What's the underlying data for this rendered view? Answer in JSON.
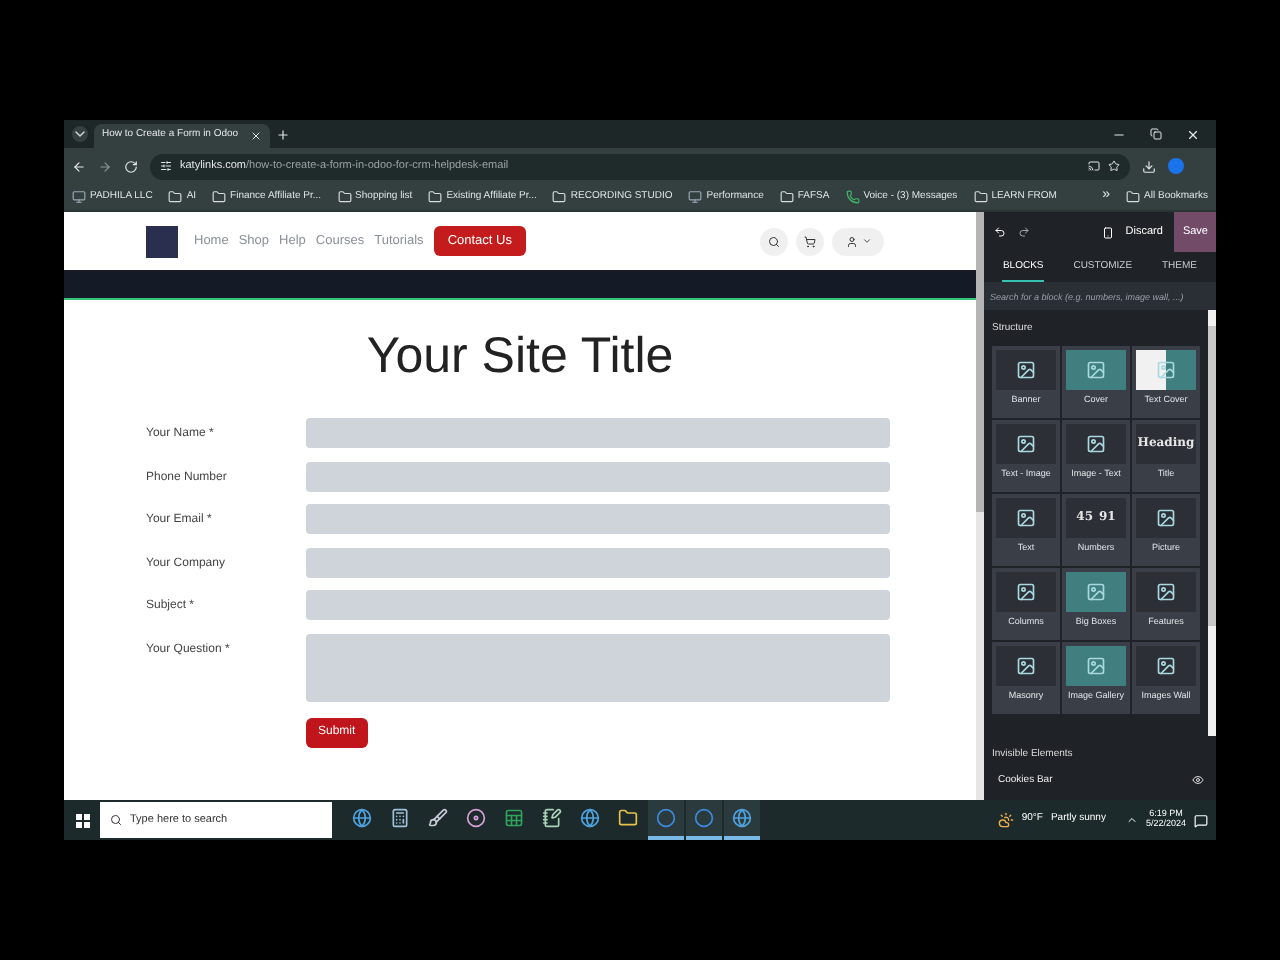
{
  "browser": {
    "tab_title": "How to Create a Form in Odoo",
    "url_host": "katylinks.com",
    "url_path": "/how-to-create-a-form-in-odoo-for-crm-helpdesk-email",
    "bookmarks": [
      {
        "label": "PADHILA LLC",
        "kind": "site"
      },
      {
        "label": "AI",
        "kind": "folder"
      },
      {
        "label": "Finance Affiliate Pr...",
        "kind": "folder"
      },
      {
        "label": "Shopping list",
        "kind": "folder"
      },
      {
        "label": "Existing Affiliate Pr...",
        "kind": "folder"
      },
      {
        "label": "RECORDING STUDIO",
        "kind": "folder"
      },
      {
        "label": "Performance",
        "kind": "site"
      },
      {
        "label": "FAFSA",
        "kind": "folder"
      },
      {
        "label": "Voice - (3) Messages",
        "kind": "phone"
      },
      {
        "label": "LEARN FROM",
        "kind": "folder"
      }
    ],
    "more": "»",
    "all_bookmarks": "All Bookmarks"
  },
  "site": {
    "nav": [
      "Home",
      "Shop",
      "Help",
      "Courses",
      "Tutorials"
    ],
    "cta": "Contact Us",
    "title": "Your Site Title",
    "fields": [
      {
        "label": "Your Name *",
        "kind": "input"
      },
      {
        "label": "Phone Number",
        "kind": "input"
      },
      {
        "label": "Your Email *",
        "kind": "input"
      },
      {
        "label": "Your Company",
        "kind": "input"
      },
      {
        "label": "Subject *",
        "kind": "input"
      },
      {
        "label": "Your Question *",
        "kind": "textarea"
      }
    ],
    "submit": "Submit"
  },
  "editor": {
    "discard": "Discard",
    "save": "Save",
    "tabs": [
      {
        "label": "BLOCKS",
        "selected": true
      },
      {
        "label": "CUSTOMIZE",
        "selected": false
      },
      {
        "label": "THEME",
        "selected": false
      }
    ],
    "search_placeholder": "Search for a block (e.g. numbers, image wall, ...)",
    "section": "Structure",
    "blocks": [
      {
        "label": "Banner",
        "kind": "plain"
      },
      {
        "label": "Cover",
        "kind": "accent"
      },
      {
        "label": "Text Cover",
        "kind": "split"
      },
      {
        "label": "Text - Image",
        "kind": "plain"
      },
      {
        "label": "Image - Text",
        "kind": "plain"
      },
      {
        "label": "Title",
        "kind": "plain",
        "preview": [
          "Heading"
        ]
      },
      {
        "label": "Text",
        "kind": "plain"
      },
      {
        "label": "Numbers",
        "kind": "plain",
        "preview": [
          "45",
          "91"
        ]
      },
      {
        "label": "Picture",
        "kind": "plain"
      },
      {
        "label": "Columns",
        "kind": "plain"
      },
      {
        "label": "Big Boxes",
        "kind": "accent"
      },
      {
        "label": "Features",
        "kind": "plain"
      },
      {
        "label": "Masonry",
        "kind": "plain"
      },
      {
        "label": "Image Gallery",
        "kind": "accent"
      },
      {
        "label": "Images Wall",
        "kind": "plain"
      }
    ],
    "invisible_heading": "Invisible Elements",
    "invisible_items": [
      "Cookies Bar"
    ]
  },
  "taskbar": {
    "search_placeholder": "Type here to search",
    "apps": [
      {
        "kind": "globe",
        "open": false
      },
      {
        "kind": "calculator",
        "open": false
      },
      {
        "kind": "brush",
        "open": false
      },
      {
        "kind": "disc",
        "open": false
      },
      {
        "kind": "sheet",
        "open": false
      },
      {
        "kind": "notebook",
        "open": false
      },
      {
        "kind": "globe",
        "open": false
      },
      {
        "kind": "folder",
        "open": false
      },
      {
        "kind": "circle",
        "open": true
      },
      {
        "kind": "circle",
        "open": true
      },
      {
        "kind": "globe",
        "open": true
      }
    ],
    "temperature": "90°F",
    "weather": "Partly sunny",
    "time": "6:19 PM",
    "date": "5/22/2024"
  }
}
